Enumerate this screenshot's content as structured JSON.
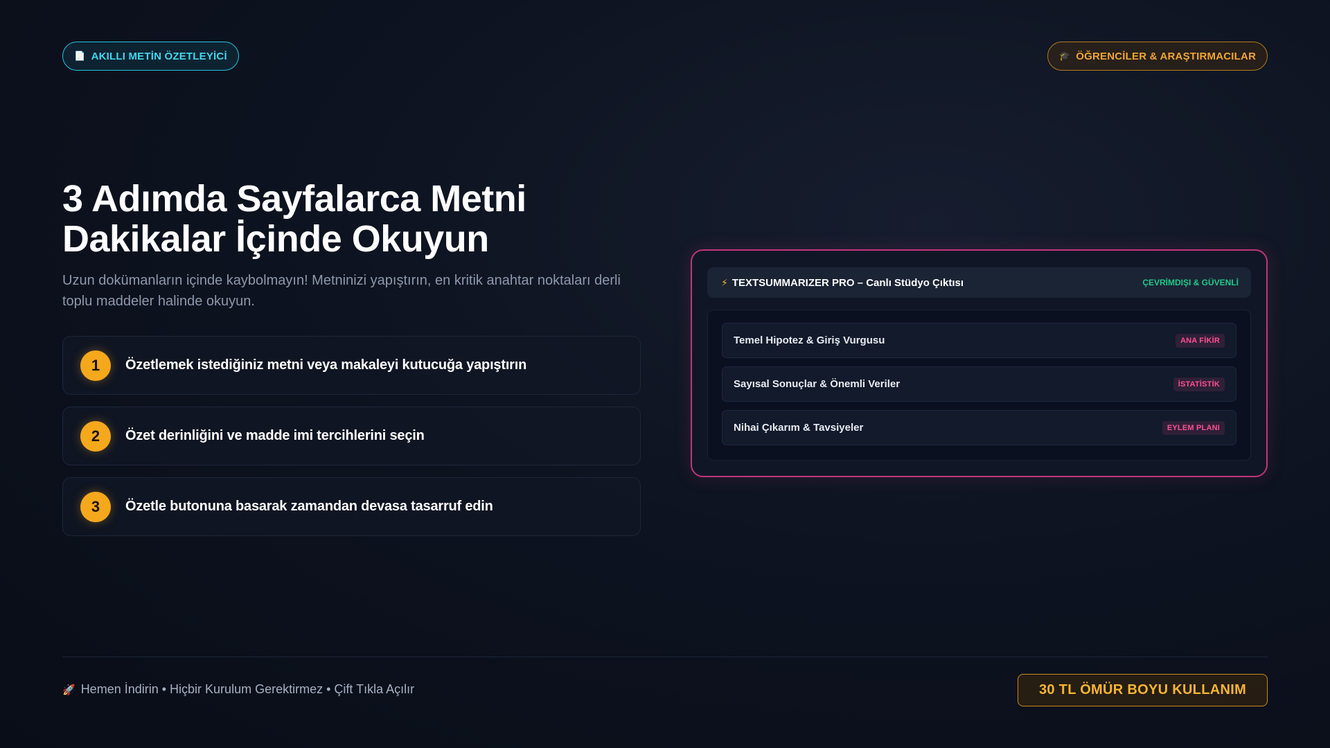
{
  "header": {
    "badge_left": "AKILLI METİN ÖZETLEYİCİ",
    "badge_left_icon": "document-icon",
    "badge_right": "ÖĞRENCİLER & ARAŞTIRMACILAR",
    "badge_right_icon": "graduation-cap-icon"
  },
  "hero": {
    "title_line1": "3 Adımda Sayfalarca Metni",
    "title_line2": "Dakikalar İçinde Okuyun",
    "subtitle": "Uzun dokümanların içinde kaybolmayın! Metninizi yapıştırın, en kritik anahtar noktaları derli toplu maddeler halinde okuyun."
  },
  "steps": [
    {
      "number": "1",
      "text": "Özetlemek istediğiniz metni veya makaleyi kutucuğa yapıştırın"
    },
    {
      "number": "2",
      "text": "Özet derinliğini ve madde imi tercihlerini seçin"
    },
    {
      "number": "3",
      "text": "Özetle butonuna basarak zamandan devasa tasarruf edin"
    }
  ],
  "studio": {
    "title": "TEXTSUMMARIZER PRO – Canlı Stüdyo Çıktısı",
    "title_icon": "lightning-icon",
    "status": "ÇEVRİMDIŞI & GÜVENLİ",
    "rows": [
      {
        "label": "Temel Hipotez & Giriş Vurgusu",
        "tag": "ANA FİKİR"
      },
      {
        "label": "Sayısal Sonuçlar & Önemli Veriler",
        "tag": "İSTATİSTİK"
      },
      {
        "label": "Nihai Çıkarım & Tavsiyeler",
        "tag": "EYLEM PLANI"
      }
    ]
  },
  "footer": {
    "note_icon": "rocket-icon",
    "note": "Hemen İndirin • Hiçbir Kurulum Gerektirmez • Çift Tıkla Açılır",
    "cta": "30 TL ÖMÜR BOYU KULLANIM"
  },
  "colors": {
    "accent_cyan": "#22c6e0",
    "accent_orange": "#f5a81c",
    "accent_pink": "#c0367a",
    "status_green": "#1fc98a"
  }
}
